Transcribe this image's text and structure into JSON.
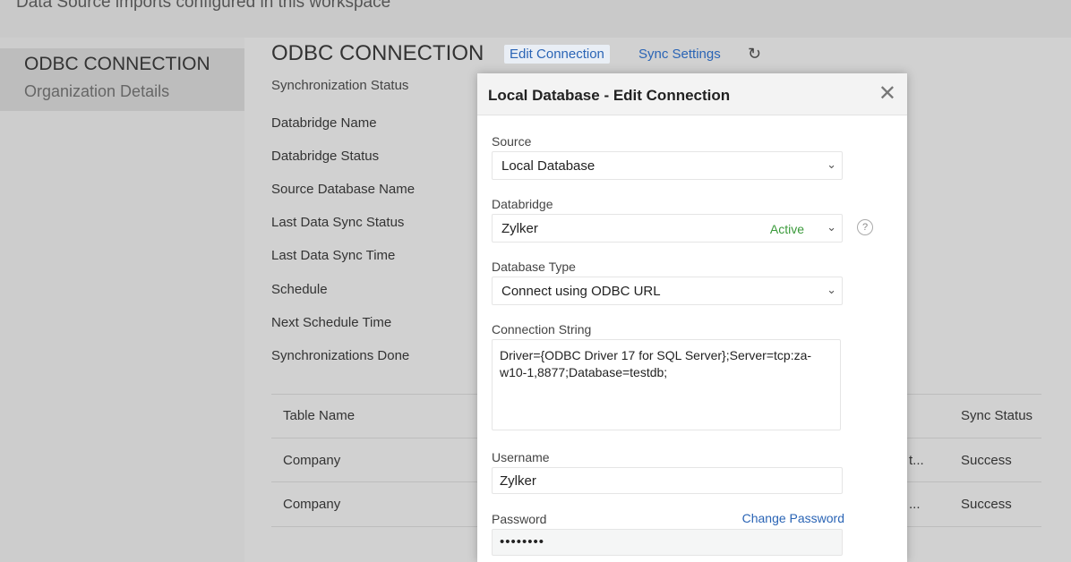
{
  "header": {
    "text": "Data Source imports configured in this workspace"
  },
  "sidebar": {
    "title": "ODBC CONNECTION",
    "subtitle": "Organization Details"
  },
  "main": {
    "title": "ODBC CONNECTION",
    "edit_link": "Edit Connection",
    "sync_link": "Sync Settings",
    "refresh_icon": "↻",
    "sync_status_label": "Synchronization Status",
    "fields": [
      "Databridge Name",
      "Databridge Status",
      "Source Database Name",
      "Last Data Sync Status",
      "Last Data Sync Time",
      "Schedule",
      "Next Schedule Time",
      "Synchronizations Done"
    ],
    "table": {
      "headers": {
        "table_name": "Table Name",
        "sync_status": "Sync Status"
      },
      "rows": [
        {
          "table_name": "Company",
          "truncated": "t...",
          "sync_status": "Success"
        },
        {
          "table_name": "Company",
          "truncated": "...",
          "sync_status": "Success"
        }
      ]
    }
  },
  "dialog": {
    "title": "Local Database - Edit Connection",
    "close_icon": "✕",
    "source": {
      "label": "Source",
      "value": "Local Database"
    },
    "databridge": {
      "label": "Databridge",
      "value": "Zylker",
      "status": "Active"
    },
    "database_type": {
      "label": "Database Type",
      "value": "Connect using ODBC URL"
    },
    "connection_string": {
      "label": "Connection String",
      "value": "Driver={ODBC Driver 17 for SQL Server};Server=tcp:za-w10-1,8877;Database=testdb;"
    },
    "username": {
      "label": "Username",
      "value": "Zylker"
    },
    "password": {
      "label": "Password",
      "value": "••••••••",
      "change_link": "Change Password"
    },
    "help_icon": "?",
    "chevron_icon": "⌄"
  }
}
